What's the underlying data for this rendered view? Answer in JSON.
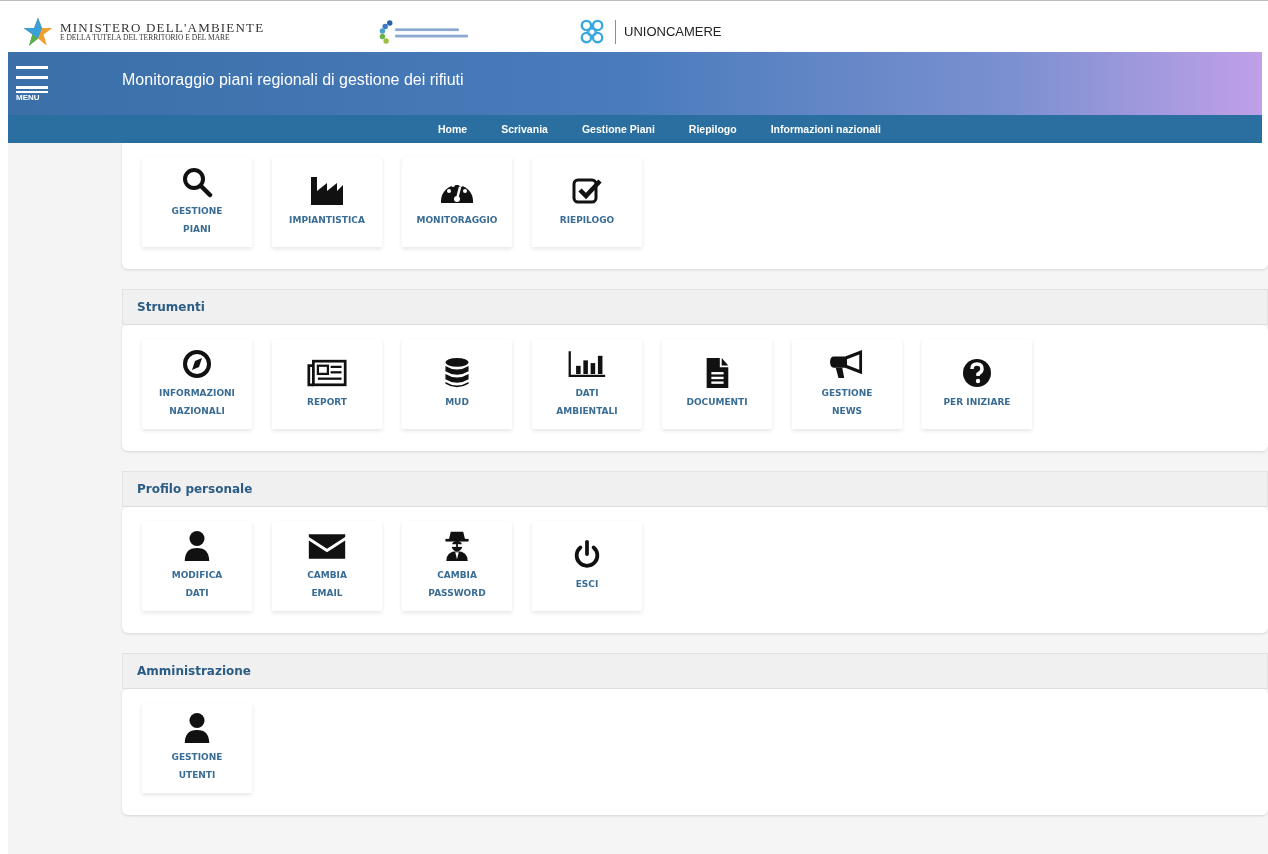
{
  "header": {
    "ministry_line1": "MINISTERO DELL'AMBIENTE",
    "ministry_line2": "E DELLA TUTELA DEL TERRITORIO E DEL MARE",
    "partner": "UNIONCAMERE"
  },
  "banner": {
    "menu_label": "MENU",
    "title": "Monitoraggio piani regionali di gestione dei rifiuti"
  },
  "nav": [
    "Home",
    "Scrivania",
    "Gestione Piani",
    "Riepilogo",
    "Informazioni nazionali"
  ],
  "sections": [
    {
      "tiles": [
        {
          "kind": "search",
          "label": "GESTIONE\nPIANI"
        },
        {
          "kind": "factory",
          "label": "IMPIANTISTICA"
        },
        {
          "kind": "gauge",
          "label": "MONITORAGGIO"
        },
        {
          "kind": "checkbox",
          "label": "RIEPILOGO"
        }
      ]
    },
    {
      "title": "Strumenti",
      "tiles": [
        {
          "kind": "compass",
          "label": "INFORMAZIONI\nNAZIONALI"
        },
        {
          "kind": "newspaper",
          "label": "REPORT"
        },
        {
          "kind": "database",
          "label": "MUD"
        },
        {
          "kind": "chart",
          "label": "DATI\nAMBIENTALI"
        },
        {
          "kind": "document",
          "label": "DOCUMENTI"
        },
        {
          "kind": "megaphone",
          "label": "GESTIONE\nNEWS"
        },
        {
          "kind": "question",
          "label": "PER INIZIARE"
        }
      ]
    },
    {
      "title": "Profilo personale",
      "tiles": [
        {
          "kind": "user",
          "label": "MODIFICA\nDATI"
        },
        {
          "kind": "envelope",
          "label": "CAMBIA\nEMAIL"
        },
        {
          "kind": "spy",
          "label": "CAMBIA\nPASSWORD"
        },
        {
          "kind": "power",
          "label": "ESCI"
        }
      ]
    },
    {
      "title": "Amministrazione",
      "tiles": [
        {
          "kind": "user",
          "label": "GESTIONE\nUTENTI"
        }
      ]
    }
  ]
}
